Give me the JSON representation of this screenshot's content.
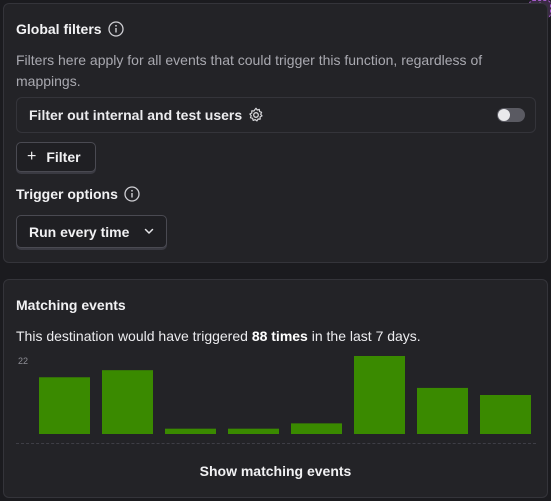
{
  "global_filters": {
    "title": "Global filters",
    "description": "Filters here apply for all events that could trigger this function, regardless of mappings.",
    "internal_filter_label": "Filter out internal and test users",
    "internal_filter_enabled": false,
    "add_filter_label": "Filter"
  },
  "trigger_options": {
    "title": "Trigger options",
    "selected": "Run every time"
  },
  "matching_events": {
    "title": "Matching events",
    "summary_prefix": "This destination would have triggered ",
    "summary_count": "88 times",
    "summary_suffix": " in the last 7 days.",
    "show_button": "Show matching events"
  },
  "colors": {
    "bar": "#3a8a00",
    "corner_add": "#a35bc7"
  },
  "chart_data": {
    "type": "bar",
    "categories": [
      "",
      "",
      "",
      "",
      "",
      "",
      "",
      ""
    ],
    "values": [
      16,
      18,
      1.5,
      1.5,
      3,
      22,
      13,
      11
    ],
    "ylim": [
      0,
      22
    ],
    "ytick_labels": [
      "22"
    ],
    "grid": false
  }
}
